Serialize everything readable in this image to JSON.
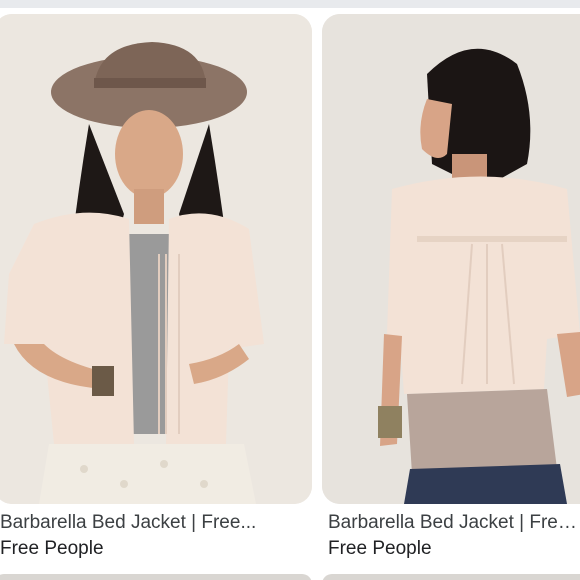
{
  "results": [
    {
      "title": "Barbarella Bed Jacket | Free...",
      "source": "Free People",
      "image_icon": "product-photo-front"
    },
    {
      "title": "Barbarella Bed Jacket | Free People",
      "source": "Free People",
      "image_icon": "product-photo-back"
    }
  ],
  "colors": {
    "caption_text": "#3c4043",
    "card_bg": "#ece7e0",
    "jacket": "#f3e2d6",
    "hat": "#8c7466"
  }
}
